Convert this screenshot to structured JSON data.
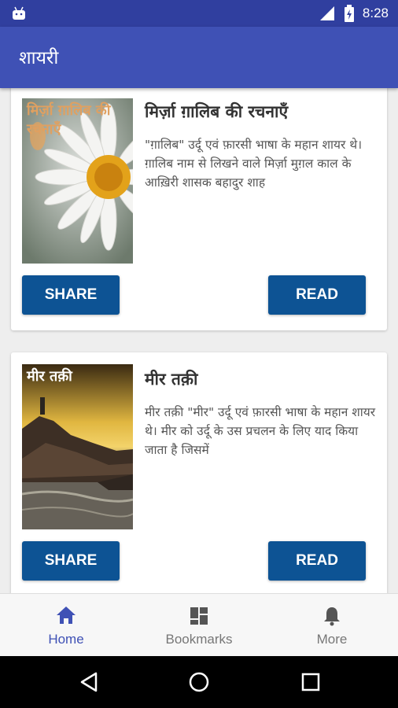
{
  "status_bar": {
    "time": "8:28",
    "icons": [
      "android-icon",
      "signal-icon",
      "battery-icon"
    ]
  },
  "app_bar": {
    "title": "शायरी",
    "color": "#3f51b5"
  },
  "cards": [
    {
      "thumb_caption": "मिर्ज़ा ग़ालिब की रचनाएँ",
      "title": "मिर्ज़ा ग़ालिब की रचनाएँ",
      "description": "\"ग़ालिब\" उर्दू एवं फ़ारसी भाषा के महान शायर थे। ग़ालिब नाम से लिखने वाले मिर्ज़ा मुग़ल काल के आख़िरी शासक बहादुर शाह",
      "share_label": "SHARE",
      "read_label": "READ"
    },
    {
      "thumb_caption": "मीर तक़ी",
      "title": "मीर तक़ी",
      "description": "मीर तक़ी \"मीर\" उर्दू एवं फ़ारसी भाषा के महान शायर थे। मीर को उर्दू के उस प्रचलन के लिए याद किया जाता है जिसमें",
      "share_label": "SHARE",
      "read_label": "READ"
    }
  ],
  "bottom_nav": [
    {
      "label": "Home",
      "icon": "home-icon",
      "active": true
    },
    {
      "label": "Bookmarks",
      "icon": "bookmarks-icon",
      "active": false
    },
    {
      "label": "More",
      "icon": "bell-icon",
      "active": false
    }
  ],
  "system_nav": [
    "back-icon",
    "home-circle-icon",
    "recents-icon"
  ],
  "colors": {
    "primary": "#3f51b5",
    "primary_dark": "#303f9f",
    "button": "#0d5394",
    "nav_active": "#3f51b5"
  }
}
